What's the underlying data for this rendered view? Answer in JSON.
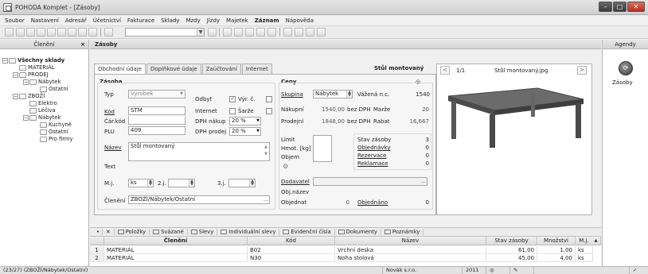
{
  "window": {
    "title": "POHODA Komplet - [Zásoby]"
  },
  "menu": [
    {
      "label": "Soubor",
      "bold": false
    },
    {
      "label": "Nastavení",
      "bold": false
    },
    {
      "label": "Adresář",
      "bold": false
    },
    {
      "label": "Účetnictví",
      "bold": false
    },
    {
      "label": "Fakturace",
      "bold": false
    },
    {
      "label": "Sklady",
      "bold": false
    },
    {
      "label": "Mzdy",
      "bold": false
    },
    {
      "label": "Jízdy",
      "bold": false
    },
    {
      "label": "Majetek",
      "bold": false
    },
    {
      "label": "Záznam",
      "bold": true
    },
    {
      "label": "Nápověda",
      "bold": false
    }
  ],
  "left_panel": {
    "title": "Členění",
    "close_glyph": "×",
    "tree": [
      {
        "label": "Všechny sklady",
        "bold": true,
        "expander": "−"
      },
      {
        "label": "MATERIÁL",
        "bold": false,
        "expander": ""
      },
      {
        "label": "PRODEJ",
        "bold": false,
        "expander": "−"
      },
      {
        "label": "Nábytek",
        "bold": false,
        "expander": "−"
      },
      {
        "label": "Ostatní",
        "bold": false,
        "expander": ""
      },
      {
        "label": "ZBOŽÍ",
        "bold": false,
        "expander": "−"
      },
      {
        "label": "Elektro",
        "bold": false,
        "expander": ""
      },
      {
        "label": "Léčiva",
        "bold": false,
        "expander": ""
      },
      {
        "label": "Nábytek",
        "bold": false,
        "expander": "−"
      },
      {
        "label": "Kuchyně",
        "bold": false,
        "expander": ""
      },
      {
        "label": "Ostatní",
        "bold": false,
        "expander": ""
      },
      {
        "label": "Pro firmy",
        "bold": false,
        "expander": ""
      }
    ]
  },
  "main": {
    "header": "Zásoby",
    "tabs": [
      "Obchodní údaje",
      "Doplňkové údaje",
      "Zaúčtování",
      "Internet"
    ],
    "record_title": "Stůl montovaný",
    "form": {
      "section_zasoba": "Zásoba",
      "typ_label": "Typ",
      "typ_value": "Výrobek",
      "odbyt_label": "Odbyt",
      "vyr_c_label": "Výr. č.",
      "vyr_c_checked": "✓",
      "kod_label": "Kód",
      "kod_value": "STM",
      "internet_label": "Internet",
      "sarze_label": "Šarže",
      "carkod_label": "Čár.kód",
      "dph_nakup_label": "DPH nákup",
      "dph_nakup_value": "20 %",
      "plu_label": "PLU",
      "plu_value": "409",
      "dph_prodej_label": "DPH prodej",
      "dph_prodej_value": "20 %",
      "nazev_label": "Název",
      "nazev_value": "Stůl montovaný",
      "text_label": "Text",
      "mj_label": "M.j.",
      "mj_value": "ks",
      "mj2_label": "2.j.",
      "mj3_label": "3.j.",
      "cleneni_label": "Členění",
      "cleneni_value": "ZBOŽÍ/Nábytek/Ostatní",
      "section_ceny": "Ceny",
      "skupina_label": "Skupina",
      "skupina_value": "Nábytek",
      "vazena_label": "Vážená n.c.",
      "vazena_value": "1540",
      "nakupni_label": "Nákupní",
      "nakupni_value": "1540,00",
      "bez_dph_1": "bez DPH",
      "marze_label": "Marže",
      "marze_value": "20",
      "prodejni_label": "Prodejní",
      "prodejni_value": "1848,00",
      "bez_dph_2": "bez DPH",
      "rabat_label": "Rabat",
      "rabat_value": "16,667",
      "limit_label": "Limit",
      "hmot_label": "Hmot. [kg]",
      "objem_label": "Objem",
      "stav_label": "Stav zásoby",
      "stav_value": "3",
      "objednavky_label": "Objednávky",
      "objednavky_value": "0",
      "rezervace_label": "Rezervace",
      "rezervace_value": "0",
      "reklamace_label": "Reklamace",
      "reklamace_value": "0",
      "dodavatel_label": "Dodavatel",
      "obj_nazev_label": "Obj.název",
      "objednat_label": "Objednat",
      "objednat_value": "0",
      "objednano_label": "Objednáno",
      "objednano_value": "0"
    },
    "image_panel": {
      "counter": "1/1",
      "filename": "Stůl montovaný.jpg",
      "prev": "<",
      "next": ">"
    }
  },
  "right_panel": {
    "title": "Agendy",
    "item": "Zásoby"
  },
  "bottom_tabs": [
    "Položky",
    "Svázané",
    "Slevy",
    "Individuální slevy",
    "Evidenční čísla",
    "Dokumenty",
    "Poznámky"
  ],
  "grid": {
    "columns": [
      "Členění",
      "Kód",
      "Název",
      "Stav zásoby",
      "Množství",
      "M.j."
    ],
    "rows": [
      {
        "num": "1",
        "cleneni": "MATERIÁL",
        "kod": "B02",
        "nazev": "Vrchní deska",
        "stav": "61,00",
        "mnozstvi": "1,00",
        "mj": "ks"
      },
      {
        "num": "2",
        "cleneni": "MATERIÁL",
        "kod": "N30",
        "nazev": "Noha stolová",
        "stav": "45,00",
        "mnozstvi": "4,00",
        "mj": "ks"
      }
    ]
  },
  "status": {
    "left": "(23/27) (ZBOŽÍ/Nábytek/Ostatní)",
    "user": "Novák s.r.o.",
    "year": "2011"
  }
}
